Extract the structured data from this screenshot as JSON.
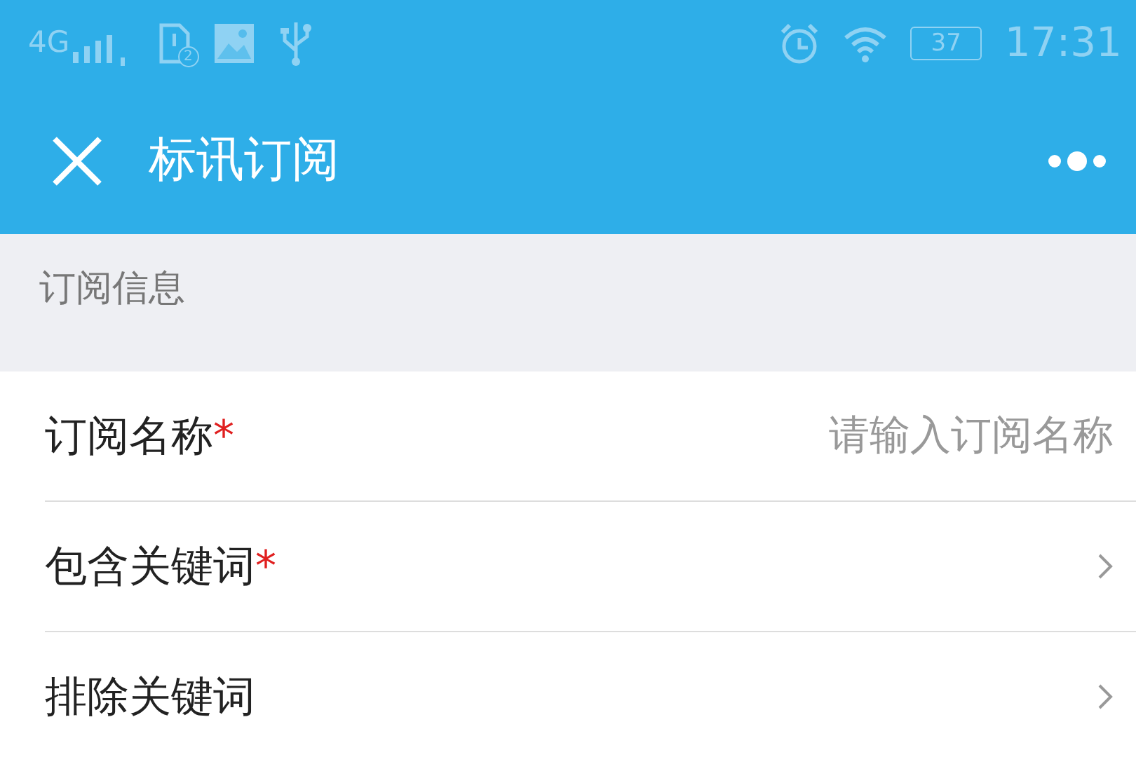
{
  "status_bar": {
    "network": "4G",
    "sim_badge": "2",
    "battery": "37",
    "time": "17:31"
  },
  "header": {
    "title": "标讯订阅"
  },
  "section": {
    "title": "订阅信息"
  },
  "fields": [
    {
      "kind": "input",
      "label": "订阅名称",
      "required_mark": "*",
      "placeholder": "请输入订阅名称"
    },
    {
      "kind": "link",
      "label": "包含关键词",
      "required_mark": "*"
    },
    {
      "kind": "link",
      "label": "排除关键词"
    }
  ]
}
